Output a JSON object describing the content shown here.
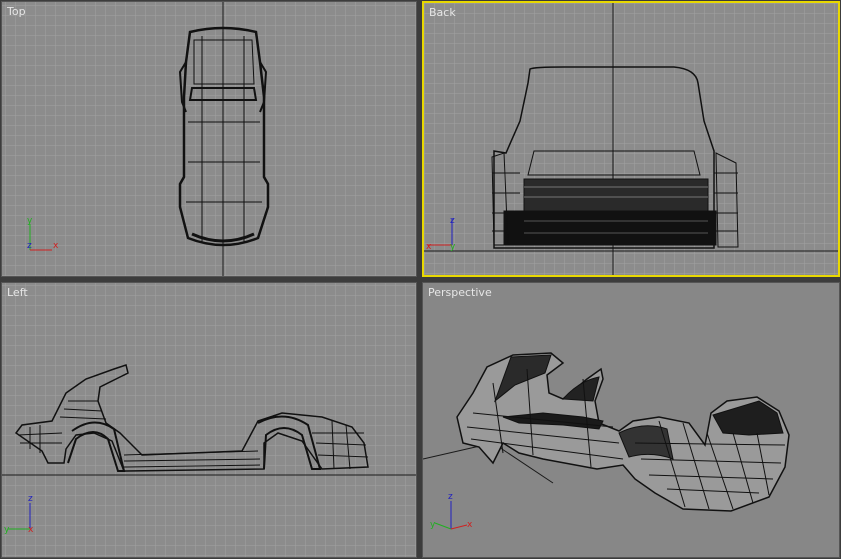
{
  "viewports": {
    "top": {
      "label": "Top",
      "axes": [
        "y",
        "z",
        "x"
      ]
    },
    "back": {
      "label": "Back",
      "axes": [
        "z",
        "x",
        "y"
      ]
    },
    "left": {
      "label": "Left",
      "axes": [
        "z",
        "y",
        "x"
      ]
    },
    "perspective": {
      "label": "Perspective",
      "axes": [
        "z",
        "y",
        "x"
      ]
    }
  },
  "colors": {
    "viewport_bg": "#8c8c8c",
    "grid_minor": "#9e9e9e",
    "grid_major": "#737373",
    "axis_line": "#1a1a1a",
    "active_border": "#e8d800",
    "axis_x": "#d02020",
    "axis_y": "#20b020",
    "axis_z": "#2020c0"
  }
}
